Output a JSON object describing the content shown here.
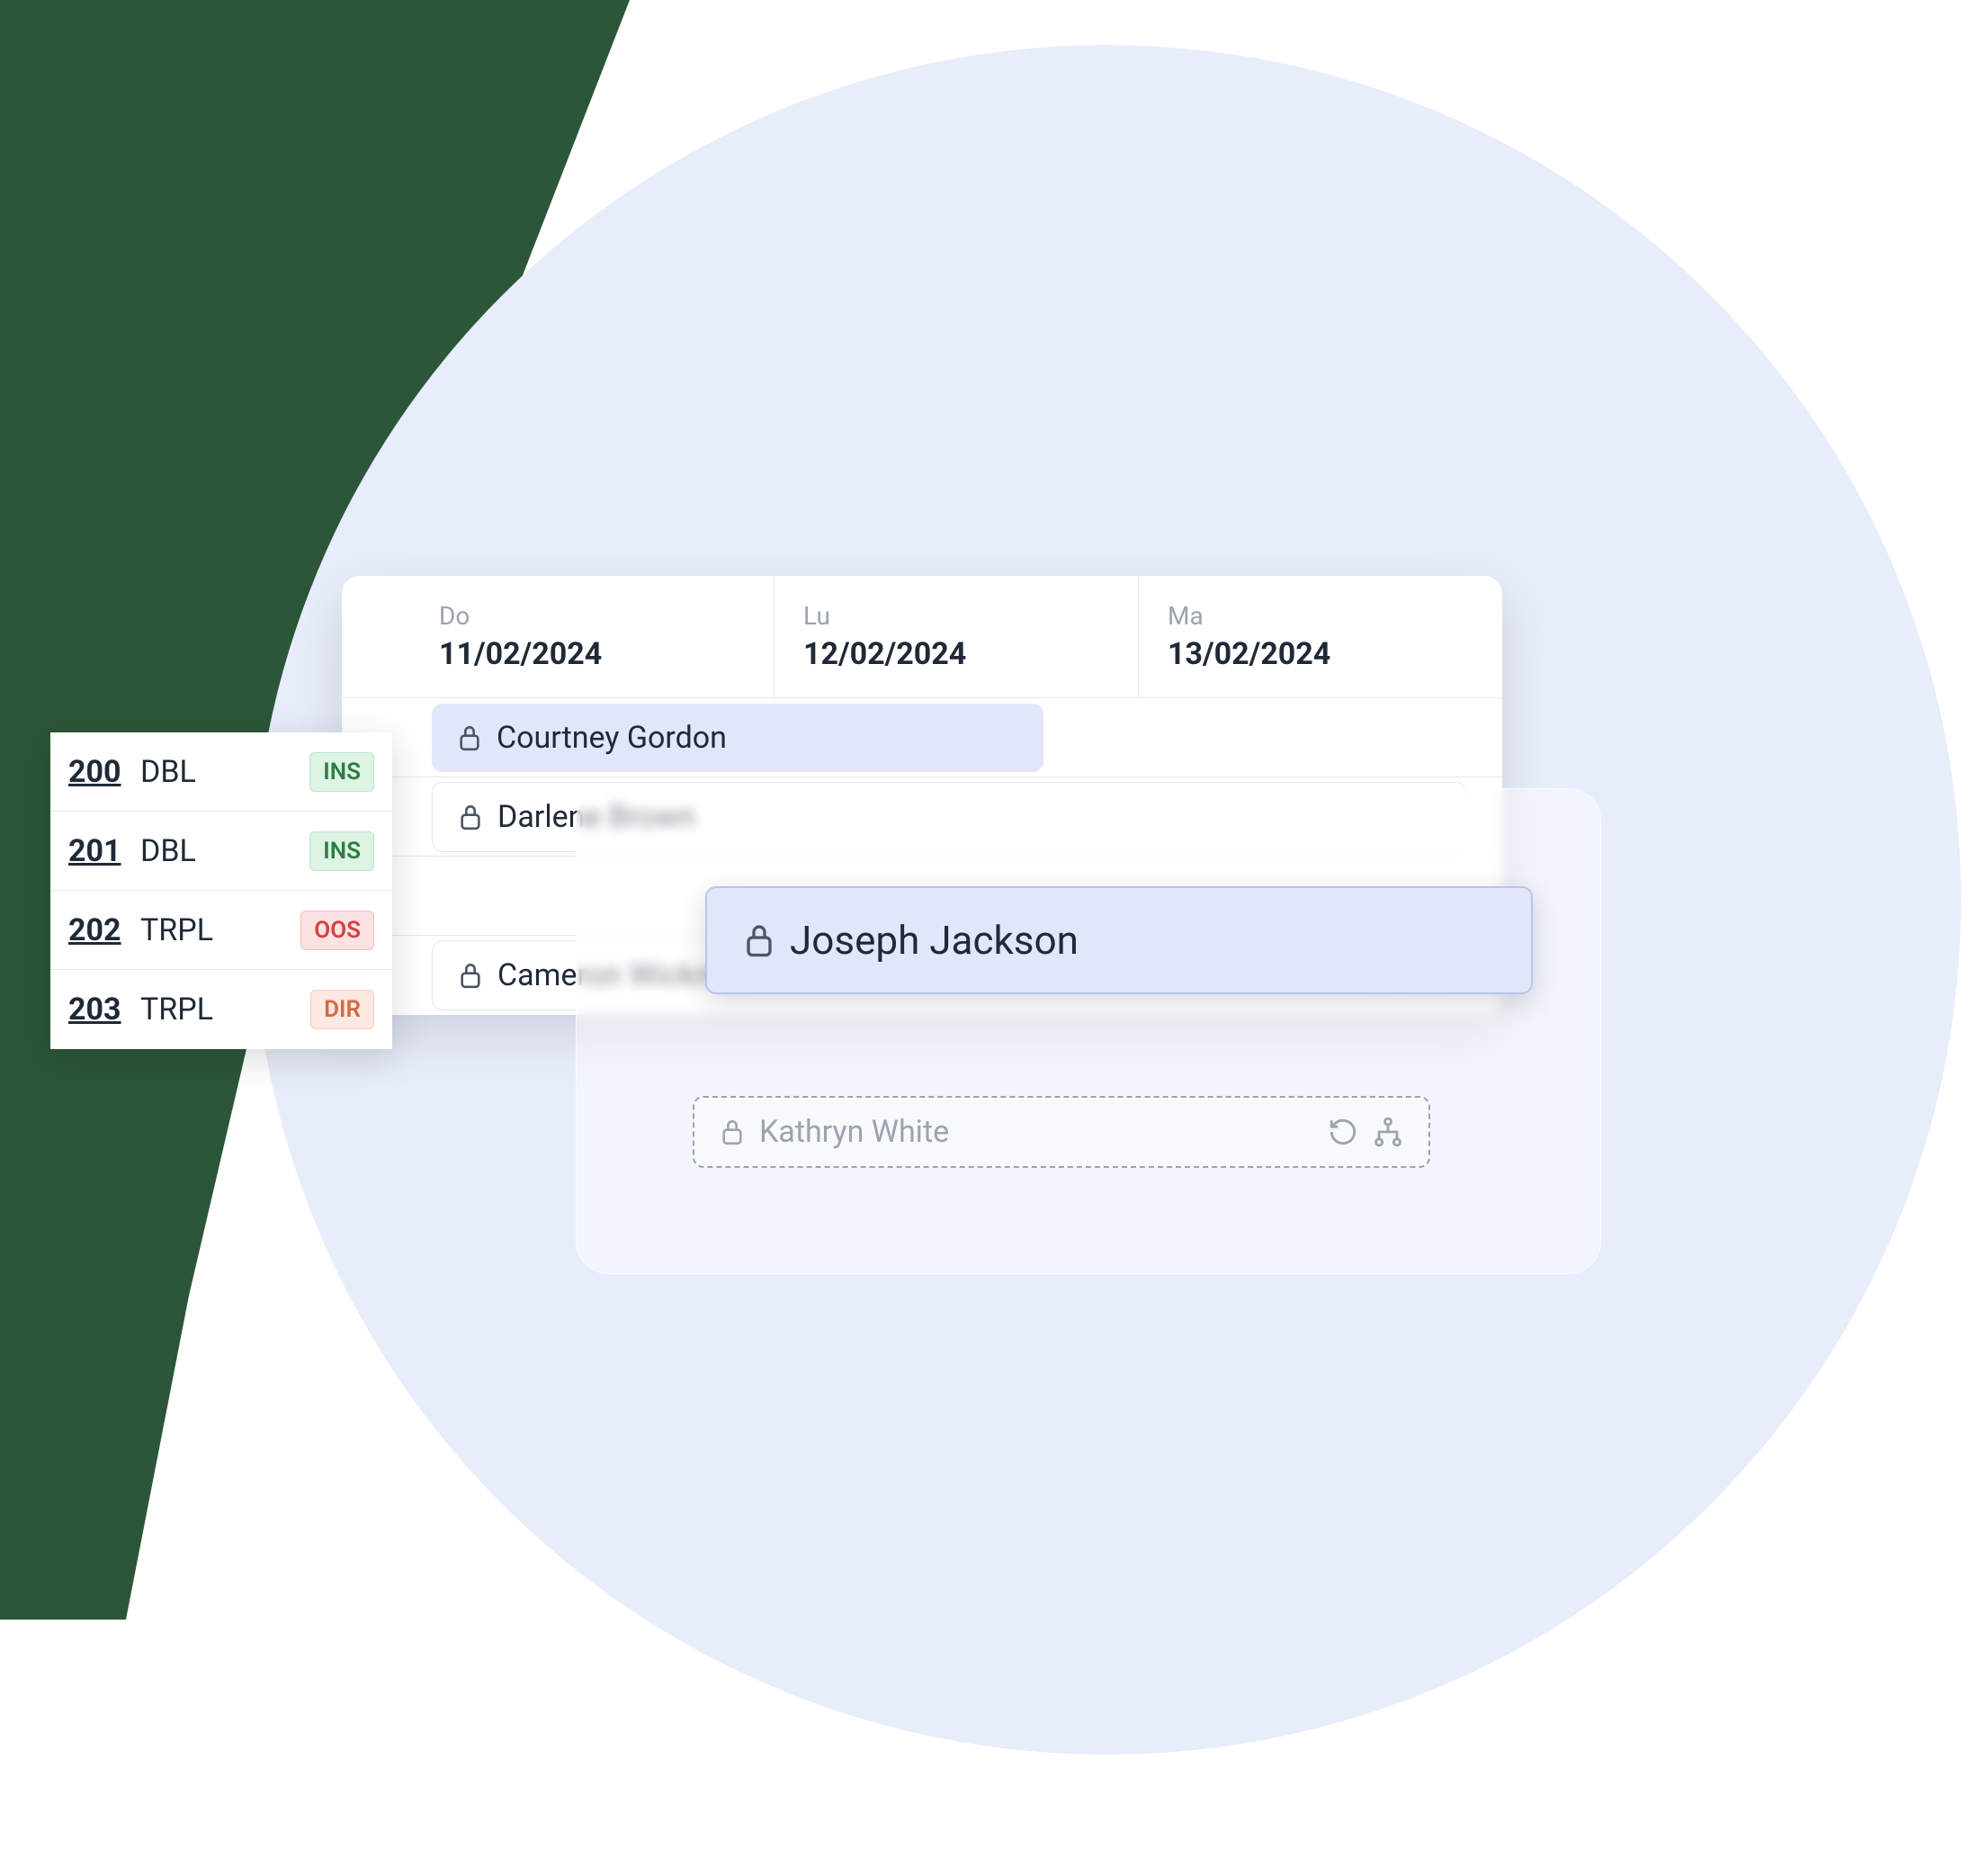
{
  "dates": [
    {
      "dow": "Do",
      "value": "11/02/2024"
    },
    {
      "dow": "Lu",
      "value": "12/02/2024"
    },
    {
      "dow": "Ma",
      "value": "13/02/2024"
    }
  ],
  "rooms": [
    {
      "number": "200",
      "type": "DBL",
      "status": "INS",
      "status_class": "ins"
    },
    {
      "number": "201",
      "type": "DBL",
      "status": "INS",
      "status_class": "ins"
    },
    {
      "number": "202",
      "type": "TRPL",
      "status": "OOS",
      "status_class": "oos"
    },
    {
      "number": "203",
      "type": "TRPL",
      "status": "DIR",
      "status_class": "dir"
    }
  ],
  "bookings": {
    "courtney": "Courtney Gordon",
    "darlene": "Darlene Brown",
    "cameron": "Cameron Wickman",
    "joseph": "Joseph Jackson",
    "kathryn": "Kathryn White"
  }
}
